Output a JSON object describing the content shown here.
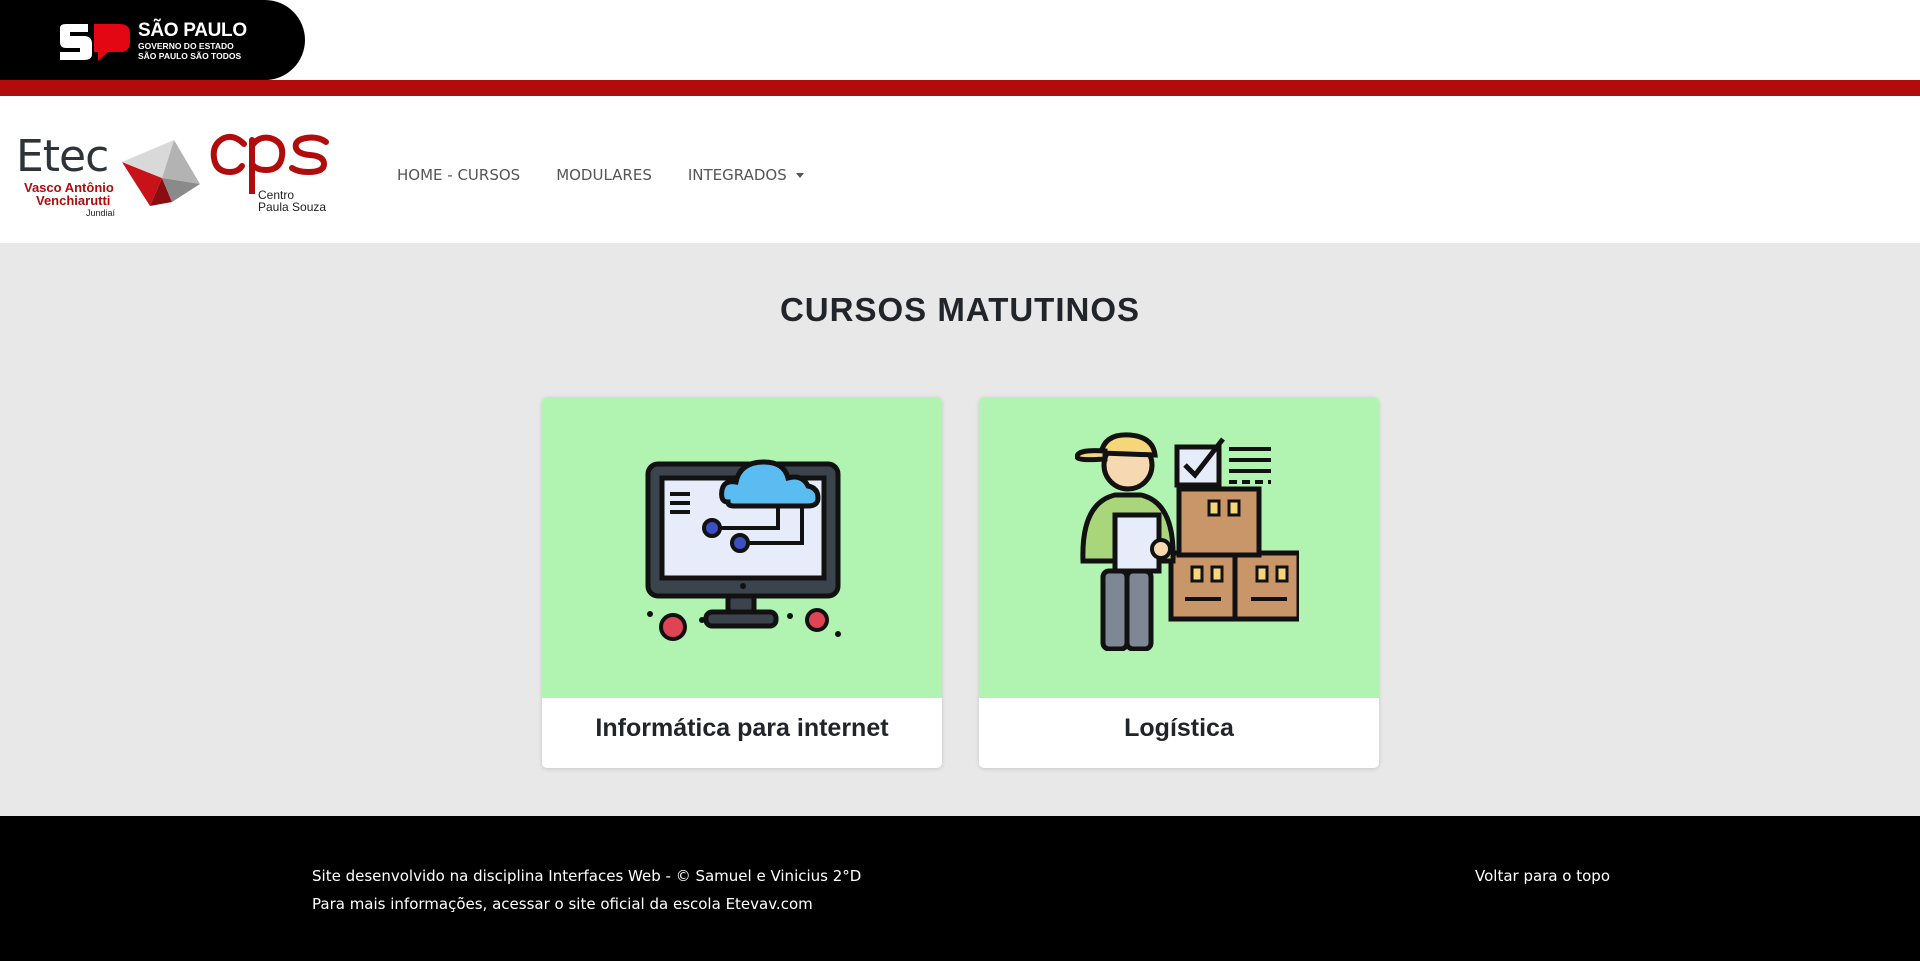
{
  "gov_header": {
    "state_name": "SÃO PAULO",
    "line1": "GOVERNO DO ESTADO",
    "line2": "SÃO PAULO SÃO TODOS"
  },
  "logos": {
    "etec_word": "Etec",
    "etec_line1": "Vasco Antônio",
    "etec_line2": "Venchiarutti",
    "etec_city": "Jundiaí",
    "cps_line1": "Centro",
    "cps_line2": "Paula Souza"
  },
  "nav": {
    "items": [
      {
        "label": "HOME - CURSOS"
      },
      {
        "label": "MODULARES"
      },
      {
        "label": "INTEGRADOS"
      }
    ]
  },
  "main": {
    "title": "CURSOS MATUTINOS",
    "cards": [
      {
        "title": "Informática para internet",
        "icon": "computer-cloud-icon"
      },
      {
        "title": "Logística",
        "icon": "delivery-worker-boxes-icon"
      }
    ]
  },
  "footer": {
    "line1": "Site desenvolvido na disciplina Interfaces Web - © Samuel e Vinicius 2°D",
    "line2_prefix": "Para mais informações, acessar o site oficial da escola ",
    "line2_link": "Etevav.com",
    "back_to_top": "Voltar para o topo"
  },
  "colors": {
    "brand_red": "#b10b0b",
    "card_image_bg": "#b1f4b2",
    "page_bg": "#e8e8e8",
    "footer_bg": "#000000"
  }
}
